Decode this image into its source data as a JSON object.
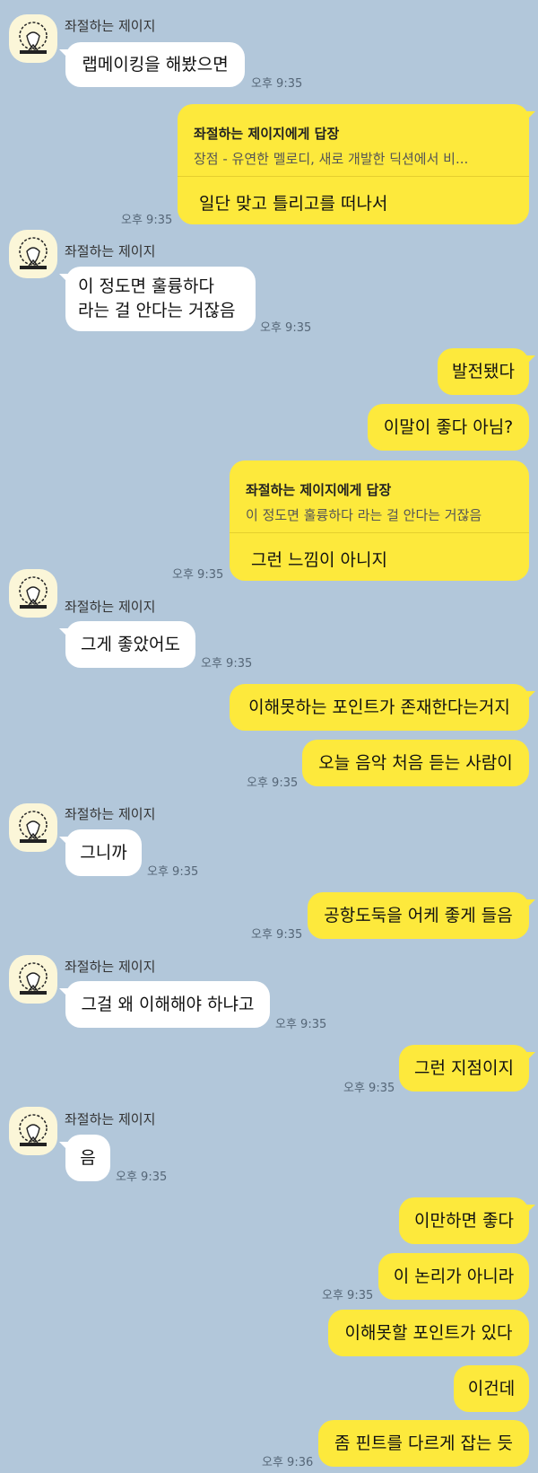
{
  "sender_name": "좌절하는 제이지",
  "colors": {
    "background": "#b2c7da",
    "incoming_bubble": "#ffffff",
    "outgoing_bubble": "#fde93c"
  },
  "messages": [
    {
      "text": "랩메이킹을 해봤으면",
      "time": "오후 9:35"
    },
    {
      "reply_title": "좌절하는 제이지에게 답장",
      "reply_quote": "장점 - 유연한 멜로디, 새로 개발한 딕션에서 비...",
      "text": "일단 맞고 틀리고를 떠나서",
      "time": "오후 9:35"
    },
    {
      "line1": "이 정도면 훌륭하다",
      "line2": "라는 걸 안다는 거잖음",
      "time": "오후 9:35"
    },
    {
      "text": "발전됐다"
    },
    {
      "text": "이말이 좋다 아님?"
    },
    {
      "reply_title": "좌절하는 제이지에게 답장",
      "reply_quote": "이 정도면 훌륭하다 라는 걸 안다는 거잖음",
      "text": "그런 느낌이 아니지",
      "time": "오후 9:35"
    },
    {
      "text": "그게 좋았어도",
      "time": "오후 9:35"
    },
    {
      "text": "이해못하는 포인트가 존재한다는거지"
    },
    {
      "text": "오늘 음악 처음 듣는 사람이",
      "time": "오후 9:35"
    },
    {
      "text": "그니까",
      "time": "오후 9:35"
    },
    {
      "text": "공항도둑을 어케 좋게 들음",
      "time": "오후 9:35"
    },
    {
      "text": "그걸 왜 이해해야 하냐고",
      "time": "오후 9:35"
    },
    {
      "text": "그런 지점이지",
      "time": "오후 9:35"
    },
    {
      "text": "음",
      "time": "오후 9:35"
    },
    {
      "text": "이만하면 좋다"
    },
    {
      "text": "이 논리가 아니라",
      "time": "오후 9:35"
    },
    {
      "text": "이해못할 포인트가 있다"
    },
    {
      "text": "이건데"
    },
    {
      "text": "좀 핀트를 다르게 잡는 듯",
      "time": "오후 9:36"
    }
  ]
}
